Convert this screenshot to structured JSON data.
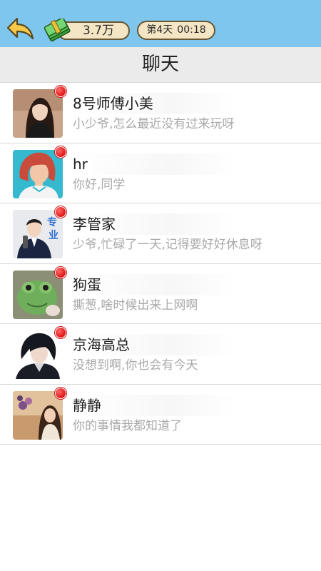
{
  "header": {
    "money": "3.7万",
    "day": "第4天",
    "time": "00:18",
    "title": "聊天"
  },
  "colors": {
    "topbar": "#7ec6ee",
    "unread_dot": "#e01414",
    "preview_text": "#a9a9a9"
  },
  "chats": [
    {
      "name": "8号师傅小美",
      "message": "小少爷,怎么最近没有过来玩呀",
      "avatar": "woman-long-hair-avatar"
    },
    {
      "name": "hr",
      "message": "你好,同学",
      "avatar": "cartoon-woman-avatar"
    },
    {
      "name": "李管家",
      "message": "少爷,忙碌了一天,记得要好好休息呀",
      "avatar": "man-suit-avatar"
    },
    {
      "name": "狗蛋",
      "message": "撕葱,啥时候出来上网啊",
      "avatar": "frog-mask-avatar"
    },
    {
      "name": "京海高总",
      "message": "没想到啊,你也会有今天",
      "avatar": "anime-man-avatar"
    },
    {
      "name": "静静",
      "message": "你的事情我都知道了",
      "avatar": "woman-flowers-avatar"
    }
  ]
}
